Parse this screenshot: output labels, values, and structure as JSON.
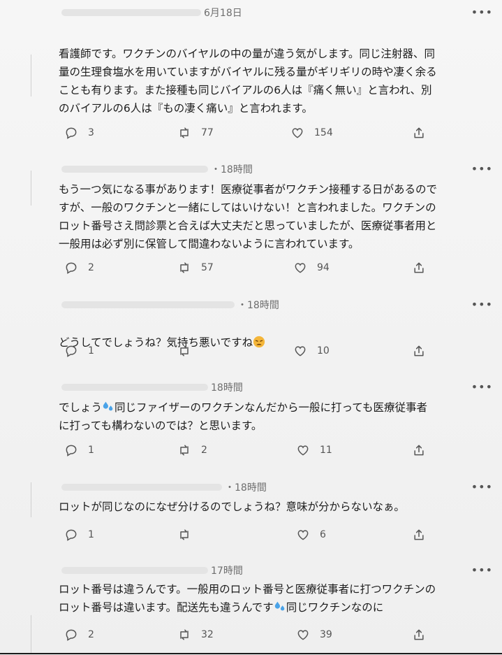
{
  "tweets": [
    {
      "time": "6月18日",
      "text": "看護師です。ワクチンのバイヤルの中の量が違う気がします。同じ注射器、同\n量の生理食塩水を用いていますがバイヤルに残る量がギリギリの時や凄く余る\nことも有ります。また接種も同じバイアルの6人は『痛く無い』と言われ、別\nのバイアルの6人は『もの凄く痛い』と言われます。",
      "replies": "3",
      "retweets": "77",
      "likes": "154"
    },
    {
      "time": "・18時間",
      "text": "もう一つ気になる事があります！医療従事者がワクチン接種する日があるので\nすが、一般のワクチンと一緒にしてはいけない！と言われました。ワクチンの\nロット番号さえ問診票と合えば大丈夫だと思っていましたが、医療従事者用と\n一般用は必ず別に保管して間違わないように言われています。",
      "replies": "2",
      "retweets": "57",
      "likes": "94"
    },
    {
      "time": "・18時間",
      "text_before": "どうしてでしょうね？気持ち悪いですね",
      "text_after": "",
      "emoji": "weary-face",
      "replies": "1",
      "retweets": "",
      "likes": "10"
    },
    {
      "time": "18時間",
      "text_before": "でしょう",
      "text_after": "同じファイザーのワクチンなんだから一般に打っても医療従事者\nに打っても構わないのでは？と思います。",
      "emoji": "sweat-droplets",
      "replies": "1",
      "retweets": "2",
      "likes": "11"
    },
    {
      "time": "・18時間",
      "text": "ロットが同じなのになぜ分けるのでしょうね？意味が分からないなぁ。",
      "replies": "1",
      "retweets": "",
      "likes": "6"
    },
    {
      "time": "17時間",
      "text_before": "ロット番号は違うんです。一般用のロット番号と医療従事者に打つワクチンの\nロット番号は違います。配送先も違うんです",
      "text_after": "同じワクチンなのに",
      "emoji": "sweat-droplets",
      "replies": "2",
      "retweets": "32",
      "likes": "39"
    }
  ],
  "more_label": "•••",
  "colors": {
    "text": "#1c1c1c",
    "muted": "#6e6e6e",
    "emoji_face": "#f4b63a",
    "emoji_drop": "#4aa3e8"
  },
  "icons": [
    "reply-icon",
    "retweet-icon",
    "like-icon",
    "share-icon",
    "more-icon"
  ]
}
